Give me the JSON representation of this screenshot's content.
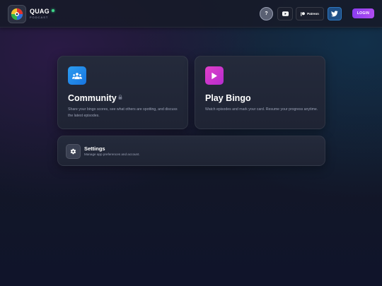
{
  "header": {
    "brand_name": "QUAG",
    "brand_sub": "PODCAST",
    "help_label": "?",
    "patreon_label": "Patreon",
    "login_label": "LOGIN"
  },
  "cards": {
    "community": {
      "title": "Community",
      "description": "Share your bingo scores, see what others are spotting, and discuss the latest episodes.",
      "icon": "users-icon",
      "accent": "#2c9cf0"
    },
    "bingo": {
      "title": "Play Bingo",
      "description": "Watch episodes and mark your card. Resume your progress anytime.",
      "icon": "play-icon",
      "accent": "#e040c8"
    },
    "settings": {
      "title": "Settings",
      "description": "Manage app preferences and account.",
      "icon": "gear-icon"
    }
  },
  "colors": {
    "login_gradient_start": "#8a3df0",
    "login_gradient_end": "#b04cf0",
    "status_dot": "#3ed68a",
    "twitter": "#1f4f86"
  }
}
